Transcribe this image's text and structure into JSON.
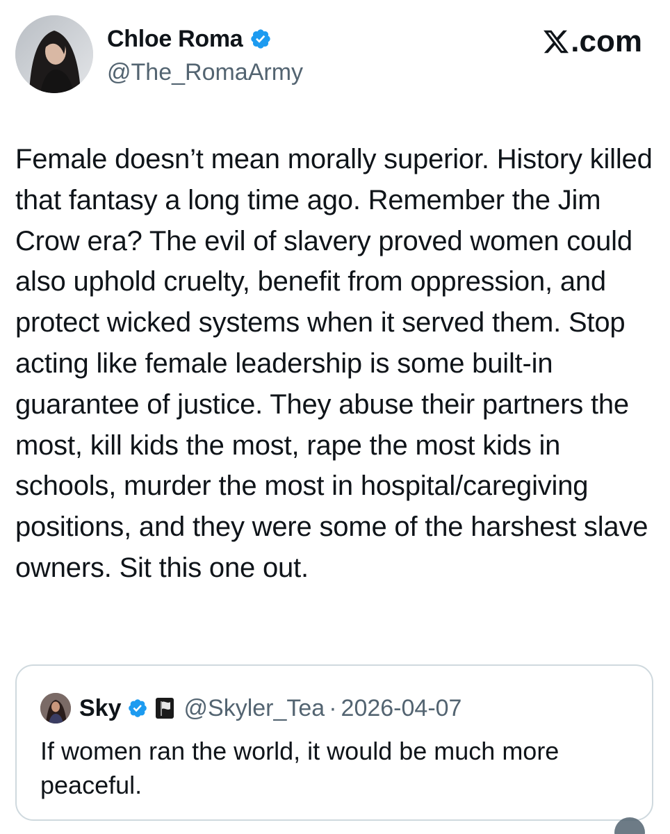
{
  "author": {
    "display_name": "Chloe Roma",
    "handle": "@The_RomaArmy",
    "verified": true,
    "avatar_icon": "profile-photo-icon"
  },
  "brand": {
    "label": ".com",
    "logo_icon": "x-logo-icon"
  },
  "tweet": {
    "text": "Female doesn’t mean morally superior. History killed that fantasy a long time ago. Remember the Jim Crow era? The evil of slavery proved women could also uphold cruelty, benefit from oppression, and protect wicked systems when it served them. Stop acting like female leadership is some built-in guarantee of justice. They abuse their partners the most, kill kids the most, rape the most kids in schools, murder the most in hospital/caregiving positions, and they were some of the harshest slave owners. Sit this one out."
  },
  "quoted_tweet": {
    "display_name": "Sky",
    "verified": true,
    "badge_icon": "black-flag-emoji-icon",
    "handle": "@Skyler_Tea",
    "separator": "·",
    "date": "2026-04-07",
    "text": "If women ran the world, it would be much more peaceful."
  },
  "colors": {
    "text_primary": "#0f1419",
    "text_secondary": "#536471",
    "verified_blue": "#1d9bf0",
    "card_border": "#cfd9de"
  }
}
